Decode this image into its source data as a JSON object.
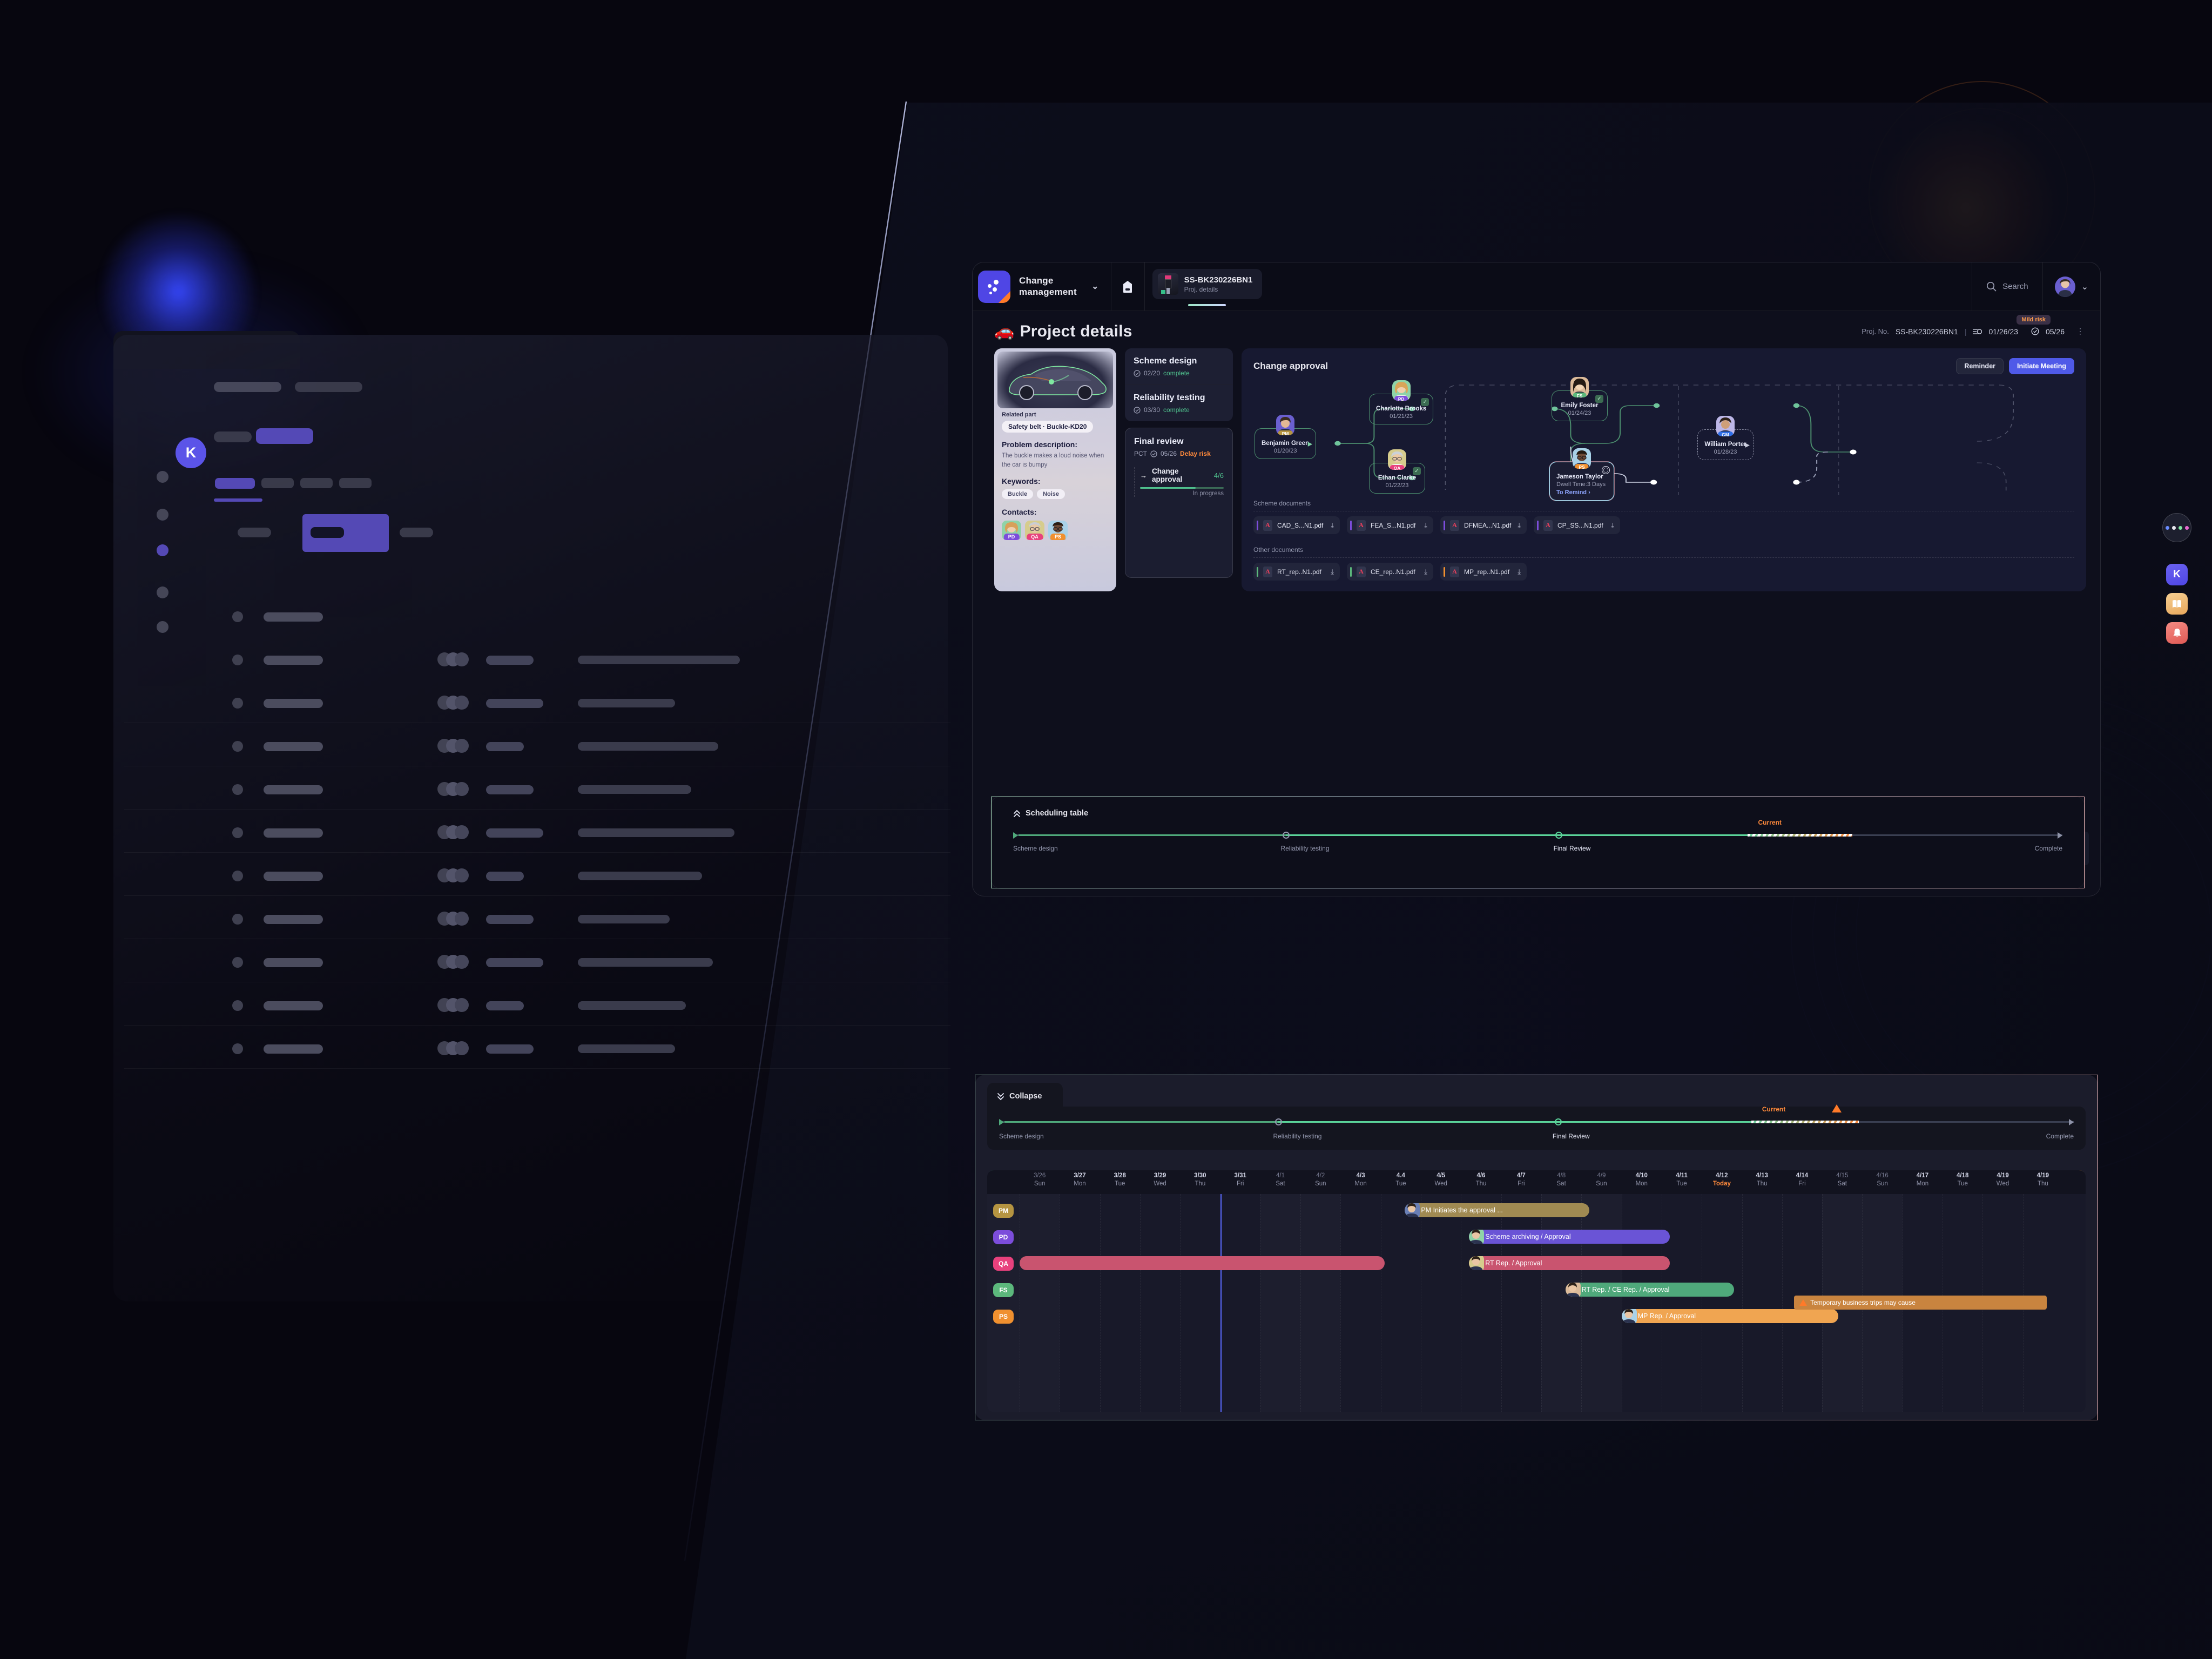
{
  "app": {
    "brand_icon": "dots-logo-icon",
    "title": "Change management",
    "chevron": "⌄",
    "doc_icon": "document-icon",
    "tab": {
      "name": "SS-BK230226BN1",
      "sub": "Proj. details"
    },
    "search": {
      "icon": "search-icon",
      "label": "Search"
    },
    "user_chevron": "⌄"
  },
  "page": {
    "emoji": "🚗",
    "title": "Project details",
    "meta": {
      "proj_label": "Proj. No.",
      "proj_no": "SS-BK230226BN1",
      "sep": "|",
      "start_icon": "schedule-icon",
      "start_date": "01/26/23",
      "due_icon": "check-circle-icon",
      "due_date": "05/26",
      "more": "⋮",
      "risk_badge": "Mild risk"
    }
  },
  "vehicle_card": {
    "related_part_label": "Related part",
    "related_part": "Safety belt · Buckle-KD20",
    "problem_heading": "Problem description:",
    "problem_text": "The buckle makes a loud noise when the car is bumpy",
    "keywords_heading": "Keywords:",
    "keywords": [
      "Buckle",
      "Noise"
    ],
    "contacts_heading": "Contacts:",
    "contacts": [
      {
        "tag": "PD",
        "tag_color": "#7c4ddb"
      },
      {
        "tag": "QA",
        "tag_color": "#e8417d"
      },
      {
        "tag": "PS",
        "tag_color": "#f0902f"
      }
    ]
  },
  "tasks": [
    {
      "title": "Scheme design",
      "date": "02/20",
      "status": "complete",
      "status_kind": "ok"
    },
    {
      "title": "Reliability testing",
      "date": "03/30",
      "status": "complete",
      "status_kind": "ok"
    }
  ],
  "final_review": {
    "title": "Final review",
    "prefix": "PCT",
    "date": "05/26",
    "status": "Delay risk",
    "sub": {
      "arrow": "→",
      "title": "Change approval",
      "count": "4/6",
      "done": 4,
      "total": 6,
      "state": "In progress"
    }
  },
  "approval": {
    "title": "Change approval",
    "buttons": {
      "reminder": "Reminder",
      "meeting": "Initiate Meeting"
    },
    "nodes": [
      {
        "id": "n1",
        "name": "Benjamin Green",
        "date": "01/20/23",
        "tag": "PM",
        "tag_color": "#b59441",
        "state": "current-play",
        "face": "#6a5fd0"
      },
      {
        "id": "n2",
        "name": "Charlotte Brooks",
        "date": "01/21/23",
        "tag": "PD",
        "tag_color": "#7c4ddb",
        "state": "approved",
        "face": "#8fd3a8"
      },
      {
        "id": "n3",
        "name": "Ethan Clarke",
        "date": "01/22/23",
        "tag": "QA",
        "tag_color": "#e8417d",
        "state": "approved",
        "face": "#d6cc8d"
      },
      {
        "id": "n4",
        "name": "Emily Foster",
        "date": "01/24/23",
        "tag": "FS",
        "tag_color": "#5cb87c",
        "state": "approved",
        "face": "#dcbb9a"
      },
      {
        "id": "n5",
        "name": "Jameson Taylor",
        "date": "Dwell Time:3 Days",
        "remind": "To Remind ›",
        "tag": "PS",
        "tag_color": "#f0902f",
        "state": "waiting",
        "face": "#a9d2e8"
      },
      {
        "id": "n6",
        "name": "William Porter",
        "date": "01/28/23",
        "tag": "GM",
        "tag_color": "#2f6fe8",
        "state": "pending",
        "face": "#bdb7e8"
      }
    ]
  },
  "documents": {
    "scheme_label": "Scheme documents",
    "other_label": "Other documents",
    "scheme": [
      {
        "name": "CAD_S...N1.pdf",
        "stripe": "#7c4ddb",
        "download": "⤓"
      },
      {
        "name": "FEA_S...N1.pdf",
        "stripe": "#7c4ddb",
        "download": "⤓"
      },
      {
        "name": "DFMEA...N1.pdf",
        "stripe": "#7c4ddb",
        "download": "⤓"
      },
      {
        "name": "CP_SS...N1.pdf",
        "stripe": "#7c4ddb",
        "download": "⤓"
      }
    ],
    "other": [
      {
        "name": "RT_rep..N1.pdf",
        "stripe": "#5cb87c",
        "download": "⤓"
      },
      {
        "name": "CE_rep..N1.pdf",
        "stripe": "#5cb87c",
        "download": "⤓"
      },
      {
        "name": "MP_rep..N1.pdf",
        "stripe": "#f0902f",
        "download": "⤓"
      }
    ]
  },
  "scheduling": {
    "icon": "collapse-up-icon",
    "title": "Scheduling table",
    "stages": [
      "Scheme design",
      "Reliability testing",
      "Final Review",
      "Complete"
    ],
    "current_label": "Current",
    "prev_arrow": "◀",
    "next_arrow": "▶"
  },
  "gantt": {
    "collapse_icon": "collapse-down-icon",
    "collapse_label": "Collapse",
    "stages": [
      "Scheme design",
      "Reliability testing",
      "Final Review",
      "Complete"
    ],
    "current_label": "Current",
    "lanes": [
      {
        "tag": "PM",
        "color": "#b59441"
      },
      {
        "tag": "PD",
        "color": "#7c4ddb"
      },
      {
        "tag": "QA",
        "color": "#e8417d"
      },
      {
        "tag": "FS",
        "color": "#5cb87c"
      },
      {
        "tag": "PS",
        "color": "#f0902f"
      }
    ],
    "days": [
      {
        "d": "3/26",
        "w": "Sun",
        "weekend": true
      },
      {
        "d": "3/27",
        "w": "Mon",
        "weekend": false
      },
      {
        "d": "3/28",
        "w": "Tue",
        "weekend": false
      },
      {
        "d": "3/29",
        "w": "Wed",
        "weekend": false
      },
      {
        "d": "3/30",
        "w": "Thu",
        "weekend": false
      },
      {
        "d": "3/31",
        "w": "Fri",
        "weekend": false
      },
      {
        "d": "4/1",
        "w": "Sat",
        "weekend": true
      },
      {
        "d": "4/2",
        "w": "Sun",
        "weekend": true
      },
      {
        "d": "4/3",
        "w": "Mon",
        "weekend": false
      },
      {
        "d": "4.4",
        "w": "Tue",
        "weekend": false
      },
      {
        "d": "4/5",
        "w": "Wed",
        "weekend": false
      },
      {
        "d": "4/6",
        "w": "Thu",
        "weekend": false
      },
      {
        "d": "4/7",
        "w": "Fri",
        "weekend": false
      },
      {
        "d": "4/8",
        "w": "Sat",
        "weekend": true
      },
      {
        "d": "4/9",
        "w": "Sun",
        "weekend": true
      },
      {
        "d": "4/10",
        "w": "Mon",
        "weekend": false
      },
      {
        "d": "4/11",
        "w": "Tue",
        "weekend": false
      },
      {
        "d": "4/12",
        "w": "Today",
        "weekend": false,
        "today": true
      },
      {
        "d": "4/13",
        "w": "Thu",
        "weekend": false
      },
      {
        "d": "4/14",
        "w": "Fri",
        "weekend": false
      },
      {
        "d": "4/15",
        "w": "Sat",
        "weekend": true
      },
      {
        "d": "4/16",
        "w": "Sun",
        "weekend": true
      },
      {
        "d": "4/17",
        "w": "Mon",
        "weekend": false
      },
      {
        "d": "4/18",
        "w": "Tue",
        "weekend": false
      },
      {
        "d": "4/19",
        "w": "Wed",
        "weekend": false
      },
      {
        "d": "4/19",
        "w": "Thu",
        "weekend": false
      }
    ],
    "bars": [
      {
        "lane": 0,
        "label": "PM Initiates the approval ...",
        "color": "#a08a52",
        "start": 9.6,
        "span": 4.6,
        "face": "#6a7fb5"
      },
      {
        "lane": 1,
        "label": "Scheme archiving / Approval",
        "color": "#6a54d6",
        "start": 11.2,
        "span": 5.0,
        "face": "#8fd3a8"
      },
      {
        "lane": 2,
        "label": "RT  Rep.  /  Approval",
        "color": "#c9546f",
        "start": 11.2,
        "span": 5.0,
        "face": "#d6cc8d"
      },
      {
        "lane": 3,
        "label": "RT Rep. / CE Rep. / Approval",
        "color": "#4fa97b",
        "start": 13.6,
        "span": 4.2,
        "face": "#dcbb9a"
      },
      {
        "lane": 4,
        "label": "MP Rep. / Approval",
        "color": "#f0a551",
        "start": 15.0,
        "span": 5.4,
        "face": "#a9d2e8"
      }
    ],
    "long_bar": {
      "lane": 2,
      "color": "#c9546f",
      "start": 0,
      "span": 9.1
    },
    "note": {
      "text": "Temporary business trips may cause",
      "icon": "warning-icon"
    }
  },
  "rail": {
    "more_icon": "more-dots-icon",
    "items": [
      {
        "icon": "brand-k-icon",
        "color": "#5b54e8"
      },
      {
        "icon": "book-icon",
        "color": "#f0c07a"
      },
      {
        "icon": "bell-icon",
        "color": "#ee6a62"
      }
    ]
  },
  "ghost_window": {
    "logo": "brand-k-icon"
  }
}
